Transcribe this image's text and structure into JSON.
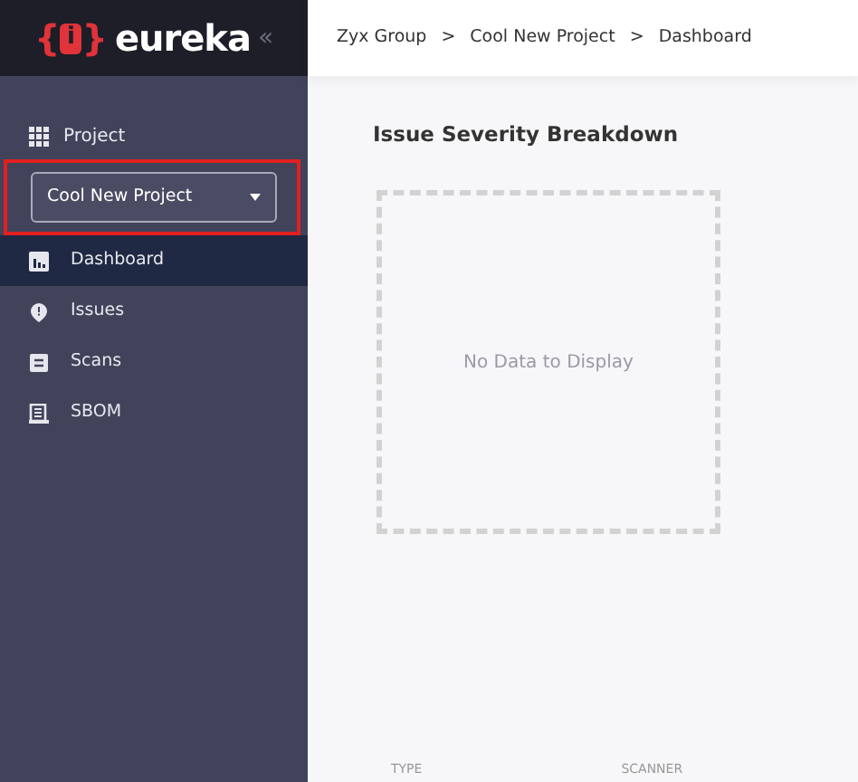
{
  "sidebar": {
    "logo": {
      "bracket_open": "{",
      "letter": "i",
      "bracket_close": "}",
      "name": "eureka",
      "collapse": "«"
    },
    "project_label": "Project",
    "project_select": {
      "value": "Cool New Project",
      "highlighted": true
    },
    "items": [
      {
        "label": "Dashboard",
        "selected": true
      },
      {
        "label": "Issues",
        "selected": false
      },
      {
        "label": "Scans",
        "selected": false
      },
      {
        "label": "SBOM",
        "selected": false
      }
    ]
  },
  "breadcrumb": [
    "Zyx Group",
    "Cool New Project",
    "Dashboard"
  ],
  "breadcrumb_separator": ">",
  "card": {
    "title": "Issue Severity Breakdown",
    "empty_text": "No Data to Display"
  },
  "table": {
    "columns": [
      "TYPE",
      "SCANNER"
    ]
  }
}
